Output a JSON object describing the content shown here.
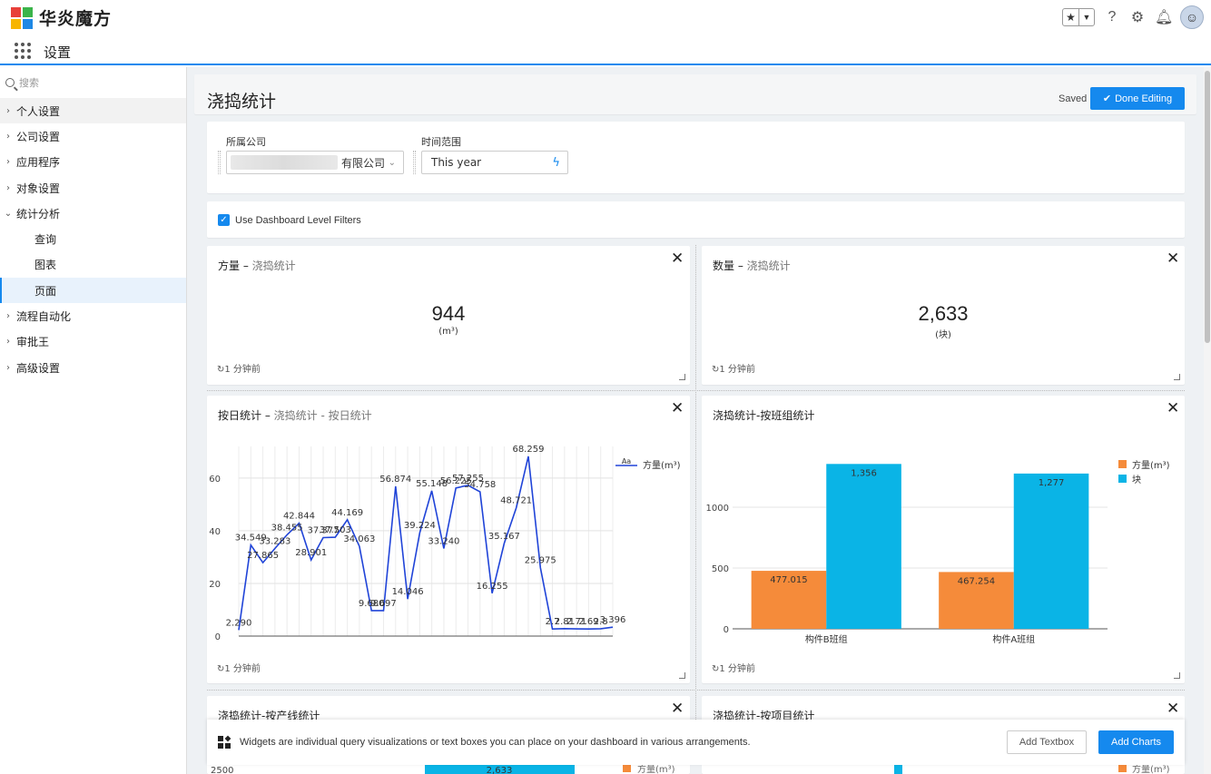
{
  "brand": {
    "name": "华炎魔方",
    "logo_colors": [
      "#e8403a",
      "#3bb44a",
      "#f7b500",
      "#1e88e5"
    ]
  },
  "app_title": "设置",
  "search_placeholder": "搜索",
  "sidebar": {
    "items": [
      {
        "label": "个人设置",
        "chevron": "›"
      },
      {
        "label": "公司设置",
        "chevron": "›"
      },
      {
        "label": "应用程序",
        "chevron": "›"
      },
      {
        "label": "对象设置",
        "chevron": "›"
      },
      {
        "label": "统计分析",
        "chevron": "⌄"
      },
      {
        "label": "查询"
      },
      {
        "label": "图表"
      },
      {
        "label": "页面"
      },
      {
        "label": "流程自动化",
        "chevron": "›"
      },
      {
        "label": "审批王",
        "chevron": "›"
      },
      {
        "label": "高级设置",
        "chevron": "›"
      }
    ]
  },
  "page": {
    "title": "浇捣统计",
    "saved": "Saved",
    "done_button": "Done Editing"
  },
  "filters": {
    "company_label": "所属公司",
    "company_value": "有限公司",
    "time_label": "时间范围",
    "time_value": "This year"
  },
  "dashboard_filter_checkbox": "Use Dashboard Level Filters",
  "widgets": {
    "w1": {
      "title": "方量",
      "subtitle": "浇捣统计",
      "value": "944",
      "unit": "(m³)",
      "refresh": "1 分钟前"
    },
    "w2": {
      "title": "数量",
      "subtitle": "浇捣统计",
      "value": "2,633",
      "unit": "(块)",
      "refresh": "1 分钟前"
    },
    "w3": {
      "title": "按日统计",
      "subtitle": "浇捣统计 - 按日统计",
      "refresh": "1 分钟前"
    },
    "w4": {
      "title": "浇捣统计-按班组统计",
      "refresh": "1 分钟前"
    },
    "w5": {
      "title": "浇捣统计-按产线统计"
    },
    "w6": {
      "title": "浇捣统计-按项目统计"
    }
  },
  "separator": "–",
  "close_icon": "✕",
  "chart_data": [
    {
      "type": "line",
      "legend": "top-right",
      "series": [
        {
          "name": "方量(m³)",
          "color": "#2044d8",
          "values": [
            2.29,
            34.549,
            27.865,
            33.283,
            38.455,
            42.844,
            28.901,
            37.377,
            37.503,
            44.169,
            34.063,
            9.68,
            9.697,
            56.874,
            14.046,
            39.224,
            55.148,
            33.24,
            56.225,
            57.255,
            54.758,
            16.255,
            35.167,
            48.721,
            68.259,
            25.975,
            2.7,
            2.81,
            2.71,
            2.69,
            2.8,
            3.36
          ]
        }
      ],
      "labels": [
        "2.290",
        "34.549",
        "27.865",
        "33.283",
        "38.455",
        "42.844",
        "28.901",
        "37.377",
        "37.503",
        "44.169",
        "34.063",
        "9.680",
        "9.697",
        "56.874",
        "14.046",
        "39.224",
        "55.148",
        "33.240",
        "56.225",
        "57.255",
        "54.758",
        "16.255",
        "35.167",
        "48.721",
        "68.259",
        "25.975",
        "2.7",
        "2.81",
        "2.71",
        "2.69",
        "2.8",
        "3.396"
      ],
      "y_ticks": [
        "0",
        "20",
        "40",
        "60"
      ],
      "legend_icon_text": "Aa",
      "ylim": [
        0,
        72
      ],
      "grid": true
    },
    {
      "type": "bar",
      "legend": "top-right",
      "categories": [
        "构件B班组",
        "构件A班组"
      ],
      "series": [
        {
          "name": "方量(m³)",
          "color": "#f58b3a",
          "values": [
            477.015,
            467.254
          ],
          "labels": [
            "477.015",
            "467.254"
          ]
        },
        {
          "name": "块",
          "color": "#0ab4e6",
          "values": [
            1356,
            1277
          ],
          "labels": [
            "1,356",
            "1,277"
          ]
        }
      ],
      "y_ticks": [
        "0",
        "500",
        "1000"
      ],
      "ylim": [
        0,
        1500
      ],
      "grid": true
    },
    {
      "type": "bar",
      "partial": true,
      "y_tick": "2500",
      "bar_label": "2,633",
      "legend_item": "方量(m³)",
      "bar_value": 2633
    },
    {
      "type": "bar",
      "partial": true,
      "legend_item": "方量(m³)"
    }
  ],
  "infobar": {
    "text": "Widgets are individual query visualizations or text boxes you can place on your dashboard in various arrangements.",
    "add_textbox": "Add Textbox",
    "add_charts": "Add Charts"
  }
}
